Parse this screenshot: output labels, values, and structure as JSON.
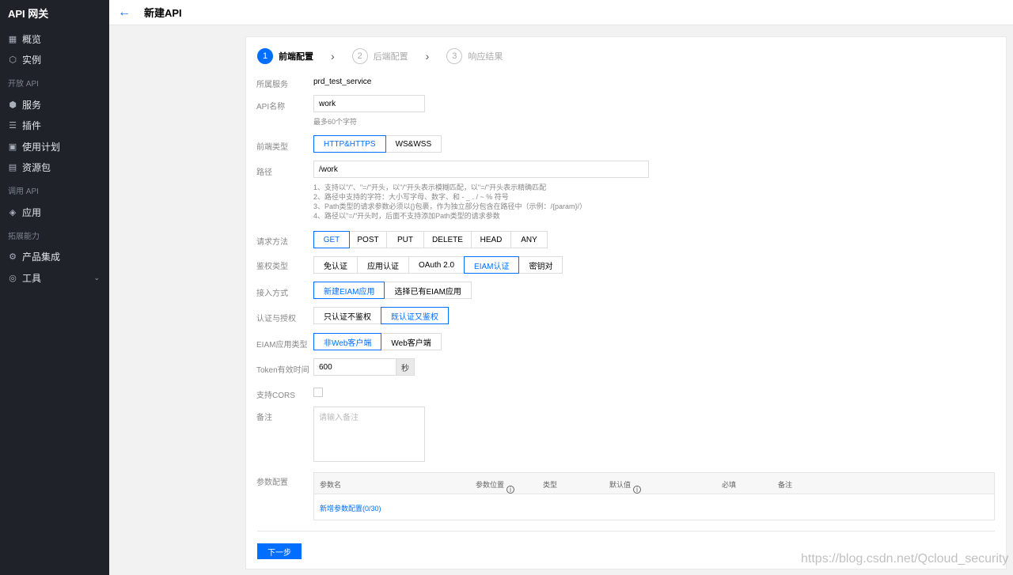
{
  "app": {
    "title": "API 网关"
  },
  "header": {
    "title": "新建API"
  },
  "sidebar": {
    "top_items": [
      {
        "label": "概览",
        "icon": "grid-icon"
      },
      {
        "label": "实例",
        "icon": "cube-icon"
      }
    ],
    "groups": [
      {
        "label": "开放 API",
        "items": [
          {
            "label": "服务",
            "icon": "hexagon-icon"
          },
          {
            "label": "插件",
            "icon": "sliders-icon"
          },
          {
            "label": "使用计划",
            "icon": "calendar-icon"
          },
          {
            "label": "资源包",
            "icon": "package-icon"
          }
        ]
      },
      {
        "label": "调用 API",
        "items": [
          {
            "label": "应用",
            "icon": "layers-icon"
          }
        ]
      },
      {
        "label": "拓展能力",
        "items": [
          {
            "label": "产品集成",
            "icon": "integration-icon"
          },
          {
            "label": "工具",
            "icon": "tool-icon"
          }
        ]
      }
    ]
  },
  "steps": [
    {
      "num": "1",
      "label": "前端配置",
      "active": true
    },
    {
      "num": "2",
      "label": "后端配置",
      "active": false
    },
    {
      "num": "3",
      "label": "响应结果",
      "active": false
    }
  ],
  "form": {
    "service": {
      "label": "所属服务",
      "value": "prd_test_service"
    },
    "api_name": {
      "label": "API名称",
      "value": "work",
      "hint": "最多60个字符"
    },
    "frontend_type": {
      "label": "前端类型",
      "options": [
        "HTTP&HTTPS",
        "WS&WSS"
      ],
      "selected": 0
    },
    "path": {
      "label": "路径",
      "value": "/work",
      "hints": [
        "1、支持以\"/\"、\"=/\"开头，以\"/\"开头表示模糊匹配，以\"=/\"开头表示精确匹配",
        "2、路径中支持的字符：大小写字母、数字、和 - _ . / ~ % 符号",
        "3、Path类型的请求参数必须以{}包裹，作为独立部分包含在路径中（示例：/{param}/）",
        "4、路径以\"=/\"开头时，后面不支持添加Path类型的请求参数"
      ]
    },
    "method": {
      "label": "请求方法",
      "options": [
        "GET",
        "POST",
        "PUT",
        "DELETE",
        "HEAD",
        "ANY"
      ],
      "selected": 0
    },
    "auth_type": {
      "label": "鉴权类型",
      "options": [
        "免认证",
        "应用认证",
        "OAuth 2.0",
        "EIAM认证",
        "密钥对"
      ],
      "selected": 3
    },
    "access": {
      "label": "接入方式",
      "options": [
        "新建EIAM应用",
        "选择已有EIAM应用"
      ],
      "selected": 0
    },
    "auth_grant": {
      "label": "认证与授权",
      "options": [
        "只认证不鉴权",
        "既认证又鉴权"
      ],
      "selected": 1
    },
    "eiam_type": {
      "label": "EIAM应用类型",
      "options": [
        "非Web客户端",
        "Web客户端"
      ],
      "selected": 0
    },
    "token_ttl": {
      "label": "Token有效时间",
      "value": "600",
      "unit": "秒"
    },
    "cors": {
      "label": "支持CORS"
    },
    "remark": {
      "label": "备注",
      "placeholder": "请输入备注"
    },
    "params": {
      "label": "参数配置",
      "columns": [
        "参数名",
        "参数位置",
        "类型",
        "默认值",
        "必填",
        "备注"
      ],
      "add_link": "新增参数配置(0/30)"
    }
  },
  "footer": {
    "next": "下一步"
  },
  "watermark": "https://blog.csdn.net/Qcloud_security",
  "colors": {
    "accent": "#006eff",
    "sidebar_bg": "#1f2329"
  }
}
